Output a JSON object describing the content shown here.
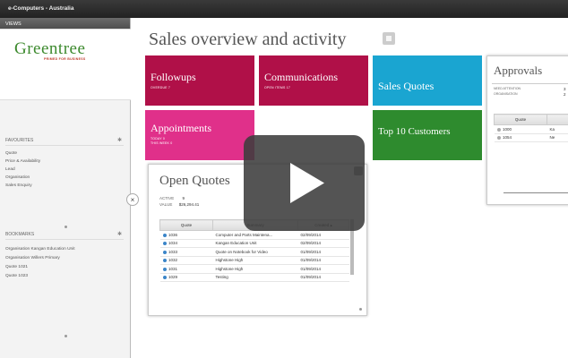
{
  "window": {
    "title": "e-Computers - Australia"
  },
  "sidebar": {
    "views_label": "VIEWS",
    "logo": {
      "name": "Greentree",
      "tagline": "PRIMED FOR BUSINESS"
    },
    "favourites": {
      "label": "FAVOURITES",
      "items": [
        "Quote",
        "Price & Availability",
        "Lead",
        "Organisation",
        "Sales Enquiry"
      ]
    },
    "bookmarks": {
      "label": "BOOKMARKS",
      "items": [
        "Organisation Kangan Education Unit",
        "Organisation Willers Primary",
        "Quote 1021",
        "Quote 1023"
      ]
    },
    "collapse_icon": "close-icon"
  },
  "main": {
    "title": "Sales overview and activity",
    "tiles": [
      {
        "title": "Followups",
        "sub": "OVERDUE  7",
        "color": "#b01048"
      },
      {
        "title": "Communications",
        "sub": "OPEN ITEMS  17",
        "color": "#b01048"
      },
      {
        "title": "Sales Quotes",
        "sub": "",
        "color": "#1aa5d1"
      },
      {
        "title": "Appointments",
        "sub1": "TODAY  0",
        "sub2": "THIS WEEK  0",
        "color": "#e0308a"
      },
      {
        "title": "Top 10 Customers",
        "sub": "",
        "color": "#2e8b2e"
      }
    ],
    "open_quotes": {
      "title": "Open Quotes",
      "active_label": "ACTIVE",
      "active_value": "9",
      "value_label": "VALUE",
      "value_value": "$26,294.41",
      "columns": [
        "Quote",
        "Summary",
        "Created"
      ],
      "rows": [
        {
          "quote": "1036",
          "summary": "Computer and Parts Maintena...",
          "created": "02/09/2014"
        },
        {
          "quote": "1034",
          "summary": "Kangan Education Unit",
          "created": "02/09/2014"
        },
        {
          "quote": "1033",
          "summary": "Quote on Notebook for Video",
          "created": "01/09/2014"
        },
        {
          "quote": "1032",
          "summary": "Highstone High",
          "created": "01/09/2014"
        },
        {
          "quote": "1031",
          "summary": "Highstone High",
          "created": "01/09/2014"
        },
        {
          "quote": "1029",
          "summary": "Testing",
          "created": "01/09/2014"
        }
      ]
    },
    "approvals": {
      "title": "Approvals",
      "need_attention_label": "NEED ATTENTION",
      "need_attention_value": "3",
      "organisation_label": "ORGANISATION",
      "organisation_value": "2",
      "column": "Quote",
      "rows": [
        {
          "quote": "1000",
          "rest": "Ka"
        },
        {
          "quote": "1054",
          "rest": "Ne"
        }
      ]
    }
  },
  "video": {
    "play_icon": "play-icon"
  }
}
